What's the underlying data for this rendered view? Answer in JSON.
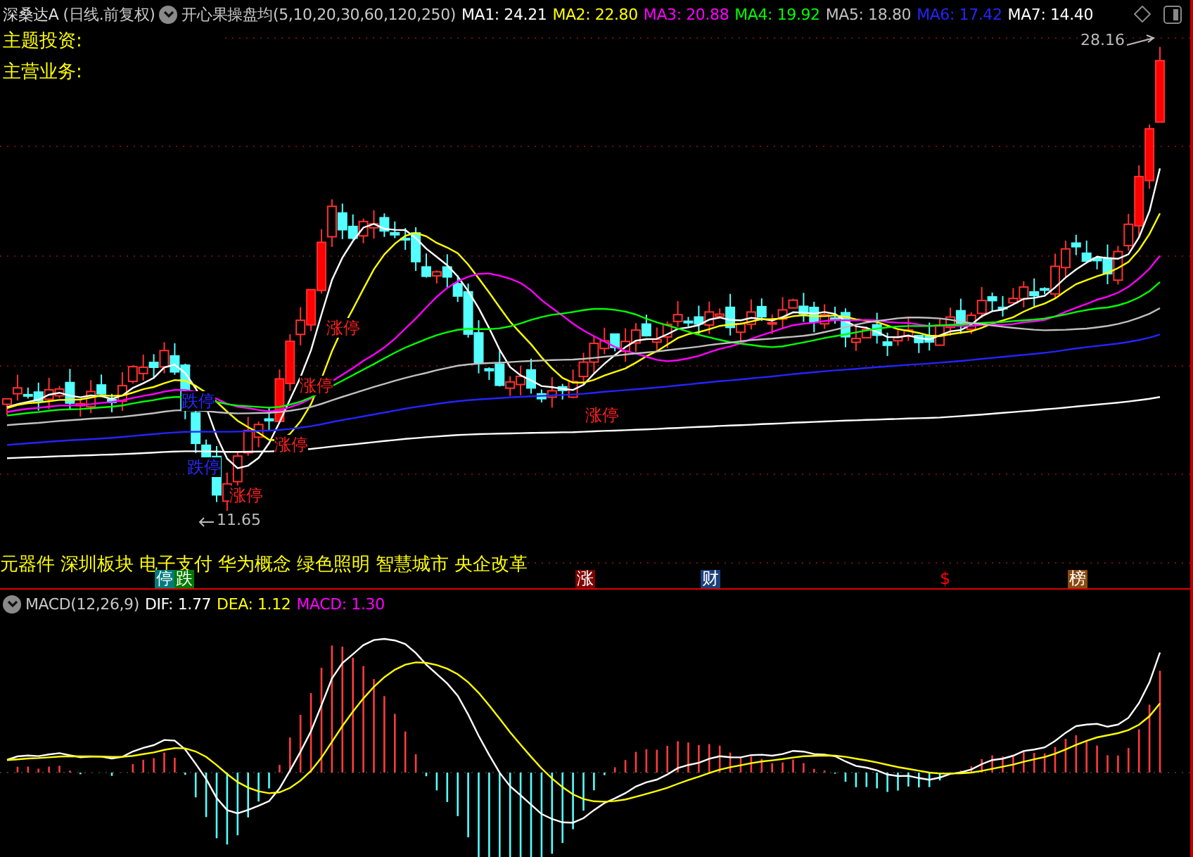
{
  "header": {
    "title": "深桑达A",
    "period": "(日线.前复权)",
    "indicator": "开心果操盘均(5,10,20,30,60,120,250)",
    "ma_values": [
      {
        "label": "MA1: 24.21",
        "color": "#ffffff"
      },
      {
        "label": "MA2: 22.80",
        "color": "#ffff00"
      },
      {
        "label": "MA3: 20.88",
        "color": "#ff00ff"
      },
      {
        "label": "MA4: 19.92",
        "color": "#00ff00"
      },
      {
        "label": "MA5: 18.80",
        "color": "#c0c0c0"
      },
      {
        "label": "MA6: 17.42",
        "color": "#2424ff"
      },
      {
        "label": "MA7: 14.40",
        "color": "#ffffff"
      }
    ]
  },
  "info": [
    {
      "label": "主题投资:"
    },
    {
      "label": "主营业务:"
    }
  ],
  "annotations": [
    {
      "text": "跌停",
      "kind": "limit_down"
    },
    {
      "text": "跌停",
      "kind": "limit_down"
    },
    {
      "text": "涨停",
      "kind": "limit_up"
    },
    {
      "text": "涨停",
      "kind": "limit_up"
    },
    {
      "text": "涨停",
      "kind": "limit_up"
    },
    {
      "text": "涨停",
      "kind": "limit_up"
    },
    {
      "text": "涨停",
      "kind": "limit_up"
    }
  ],
  "price_marks": [
    {
      "text": "28.16",
      "kind": "high"
    },
    {
      "text": "11.65",
      "kind": "low"
    }
  ],
  "concepts": [
    "元器件",
    "深圳板块",
    "电子支付",
    "华为概念",
    "绿色照明",
    "智慧城市",
    "央企改革"
  ],
  "event_badges": [
    {
      "text": "停",
      "kind": "tile",
      "color": "#007b7b"
    },
    {
      "text": "跌",
      "kind": "tile",
      "color": "#007800"
    },
    {
      "text": "涨",
      "kind": "tile",
      "color": "#800000"
    },
    {
      "text": "财",
      "kind": "tile",
      "color": "#1c3f7c"
    },
    {
      "text": "$",
      "kind": "glyph",
      "color": "#ff0000"
    },
    {
      "text": "榜",
      "kind": "tile",
      "color": "#8a4a10"
    }
  ],
  "macd": {
    "title": "MACD(12,26,9)",
    "values": [
      {
        "label": "DIF: 1.77",
        "color": "#ffffff"
      },
      {
        "label": "DEA: 1.12",
        "color": "#ffff00"
      },
      {
        "label": "MACD: 1.30",
        "color": "#ff00ff"
      }
    ]
  }
}
